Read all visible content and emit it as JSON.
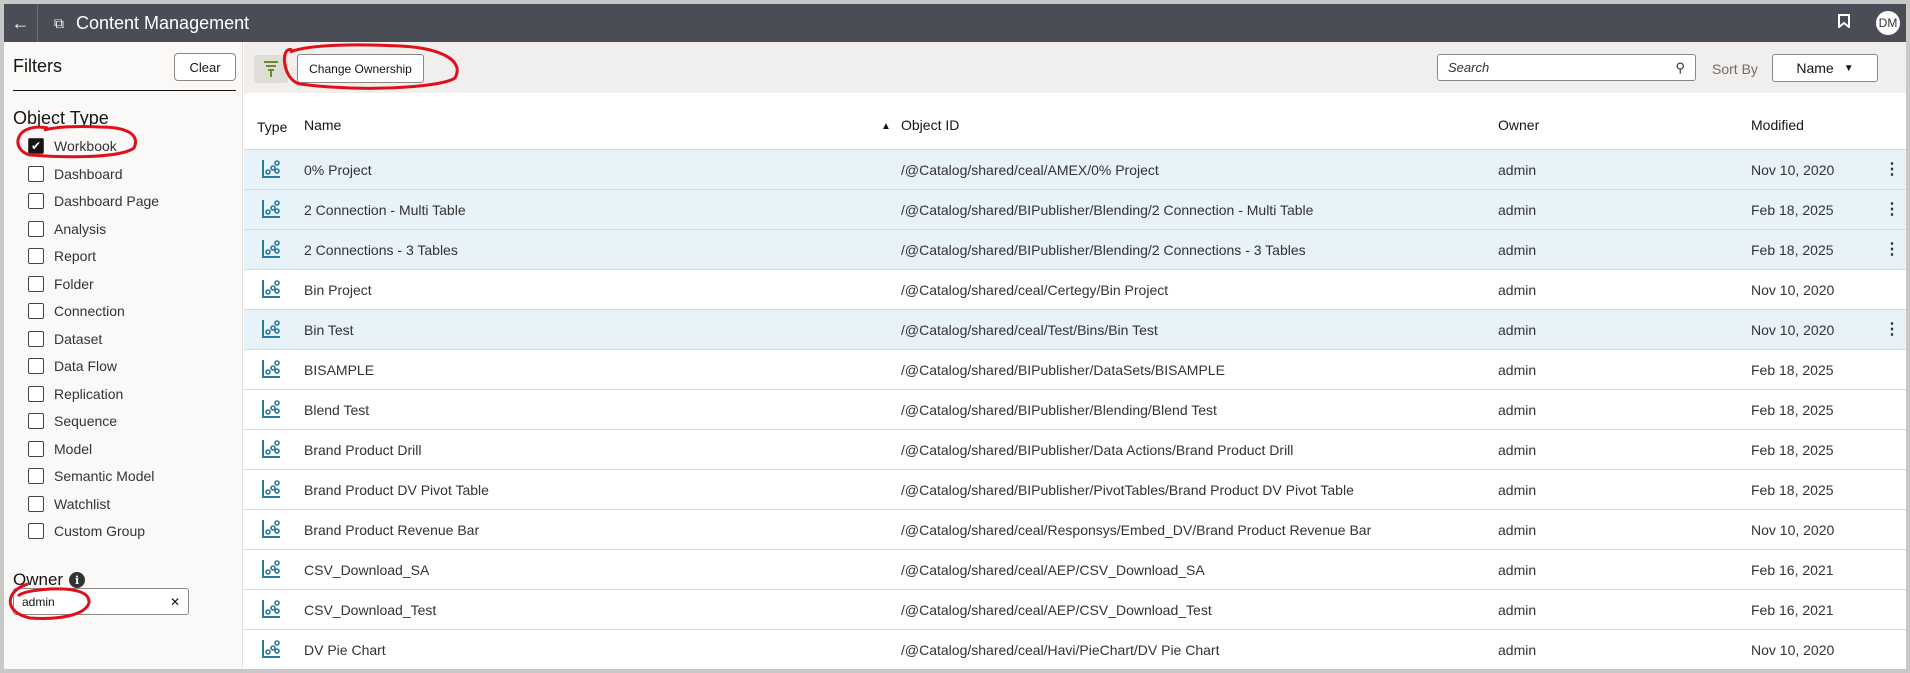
{
  "header": {
    "title": "Content Management",
    "avatar": "DM",
    "icons": [
      "back-arrow-icon",
      "content-icon",
      "bookmark-icon"
    ]
  },
  "sidebar": {
    "title": "Filters",
    "clear": "Clear",
    "object_type_label": "Object Type",
    "types": [
      {
        "label": "Workbook",
        "checked": true
      },
      {
        "label": "Dashboard",
        "checked": false
      },
      {
        "label": "Dashboard Page",
        "checked": false
      },
      {
        "label": "Analysis",
        "checked": false
      },
      {
        "label": "Report",
        "checked": false
      },
      {
        "label": "Folder",
        "checked": false
      },
      {
        "label": "Connection",
        "checked": false
      },
      {
        "label": "Dataset",
        "checked": false
      },
      {
        "label": "Data Flow",
        "checked": false
      },
      {
        "label": "Replication",
        "checked": false
      },
      {
        "label": "Sequence",
        "checked": false
      },
      {
        "label": "Model",
        "checked": false
      },
      {
        "label": "Semantic Model",
        "checked": false
      },
      {
        "label": "Watchlist",
        "checked": false
      },
      {
        "label": "Custom Group",
        "checked": false
      }
    ],
    "owner_label": "Owner",
    "owner_value": "admin"
  },
  "toolbar": {
    "change_ownership": "Change Ownership",
    "search_placeholder": "Search",
    "sort_by_label": "Sort By",
    "sort_value": "Name"
  },
  "table": {
    "columns": {
      "type": "Type",
      "name": "Name",
      "object_id": "Object ID",
      "owner": "Owner",
      "modified": "Modified"
    },
    "rows": [
      {
        "name": "0% Project",
        "id": "/@Catalog/shared/ceal/AMEX/0% Project",
        "owner": "admin",
        "modified": "Nov 10, 2020",
        "selected": true
      },
      {
        "name": "2 Connection - Multi Table",
        "id": "/@Catalog/shared/BIPublisher/Blending/2 Connection - Multi Table",
        "owner": "admin",
        "modified": "Feb 18, 2025",
        "selected": true
      },
      {
        "name": "2 Connections - 3 Tables",
        "id": "/@Catalog/shared/BIPublisher/Blending/2 Connections - 3 Tables",
        "owner": "admin",
        "modified": "Feb 18, 2025",
        "selected": true
      },
      {
        "name": "Bin Project",
        "id": "/@Catalog/shared/ceal/Certegy/Bin Project",
        "owner": "admin",
        "modified": "Nov 10, 2020",
        "selected": false
      },
      {
        "name": "Bin Test",
        "id": "/@Catalog/shared/ceal/Test/Bins/Bin Test",
        "owner": "admin",
        "modified": "Nov 10, 2020",
        "selected": true
      },
      {
        "name": "BISAMPLE",
        "id": "/@Catalog/shared/BIPublisher/DataSets/BISAMPLE",
        "owner": "admin",
        "modified": "Feb 18, 2025",
        "selected": false
      },
      {
        "name": "Blend Test",
        "id": "/@Catalog/shared/BIPublisher/Blending/Blend Test",
        "owner": "admin",
        "modified": "Feb 18, 2025",
        "selected": false
      },
      {
        "name": "Brand Product Drill",
        "id": "/@Catalog/shared/BIPublisher/Data Actions/Brand Product Drill",
        "owner": "admin",
        "modified": "Feb 18, 2025",
        "selected": false
      },
      {
        "name": "Brand Product DV Pivot Table",
        "id": "/@Catalog/shared/BIPublisher/PivotTables/Brand Product DV Pivot Table",
        "owner": "admin",
        "modified": "Feb 18, 2025",
        "selected": false
      },
      {
        "name": "Brand Product Revenue Bar",
        "id": "/@Catalog/shared/ceal/Responsys/Embed_DV/Brand Product Revenue Bar",
        "owner": "admin",
        "modified": "Nov 10, 2020",
        "selected": false
      },
      {
        "name": "CSV_Download_SA",
        "id": "/@Catalog/shared/ceal/AEP/CSV_Download_SA",
        "owner": "admin",
        "modified": "Feb 16, 2021",
        "selected": false
      },
      {
        "name": "CSV_Download_Test",
        "id": "/@Catalog/shared/ceal/AEP/CSV_Download_Test",
        "owner": "admin",
        "modified": "Feb 16, 2021",
        "selected": false
      },
      {
        "name": "DV Pie Chart",
        "id": "/@Catalog/shared/ceal/Havi/PieChart/DV Pie Chart",
        "owner": "admin",
        "modified": "Nov 10, 2020",
        "selected": false
      }
    ]
  },
  "colors": {
    "header": "#4a4d55",
    "selected_row": "#e7f2f9",
    "icon": "#2b7a9b",
    "annotation": "#e0101a"
  }
}
